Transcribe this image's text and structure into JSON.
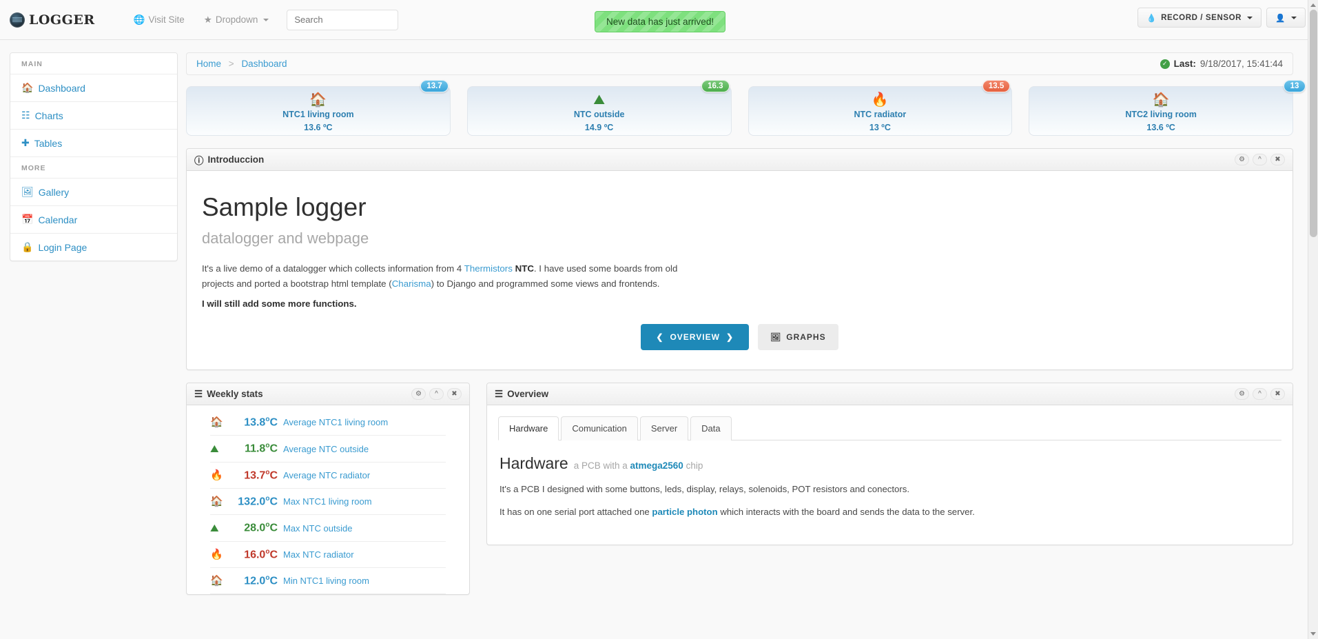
{
  "navbar": {
    "brand": "LOGGER",
    "links": [
      {
        "label": "Visit Site",
        "icon": "globe-icon"
      },
      {
        "label": "Dropdown",
        "icon": "star-icon"
      }
    ],
    "search_placeholder": "Search",
    "alert": "New data has just arrived!",
    "record_button": "RECORD / SENSOR",
    "user_icon": "user-icon"
  },
  "sidebar": {
    "groups": [
      {
        "heading": "MAIN",
        "items": [
          {
            "label": "Dashboard",
            "icon": "home-icon"
          },
          {
            "label": "Charts",
            "icon": "list-alt-icon"
          },
          {
            "label": "Tables",
            "icon": "plus-icon"
          }
        ]
      },
      {
        "heading": "MORE",
        "items": [
          {
            "label": "Gallery",
            "icon": "picture-icon"
          },
          {
            "label": "Calendar",
            "icon": "calendar-icon"
          },
          {
            "label": "Login Page",
            "icon": "lock-icon"
          }
        ]
      }
    ]
  },
  "breadcrumb": {
    "home": "Home",
    "separator": ">",
    "current": "Dashboard",
    "last_label": "Last:",
    "last_value": "9/18/2017, 15:41:44"
  },
  "sensor_cards": [
    {
      "title": "NTC1 living room",
      "value": "13.6 ºC",
      "badge": "13.7",
      "badge_color": "#3aa5db",
      "icon": "home-icon",
      "icon_color": "#2d8fc4"
    },
    {
      "title": "NTC outside",
      "value": "14.9 ºC",
      "badge": "16.3",
      "badge_color": "#4cae4c",
      "icon": "road-icon",
      "icon_color": "#3a8c3a"
    },
    {
      "title": "NTC radiator",
      "value": "13 ºC",
      "badge": "13.5",
      "badge_color": "#e5603f",
      "icon": "fire-icon",
      "icon_color": "#c0392b"
    },
    {
      "title": "NTC2 living room",
      "value": "13.6 ºC",
      "badge": "13",
      "badge_color": "#3aa5db",
      "icon": "home-icon",
      "icon_color": "#2d8fc4"
    }
  ],
  "intro_panel": {
    "title": "Introduccion",
    "title_icon": "info-circle-icon",
    "tools": [
      "gear-icon",
      "chevron-up-icon",
      "close-icon"
    ],
    "hero": "Sample logger",
    "subtitle": "datalogger and webpage",
    "paragraph_part1": "It's a live demo of a datalogger which collects information from 4 ",
    "link_thermistors": "Thermistors",
    "paragraph_ntc": "NTC",
    "paragraph_part2": ". I have used some boards from old projects and ported a bootstrap html template (",
    "link_charisma": "Charisma",
    "paragraph_part3": ") to Django and programmed some views and frontends.",
    "strong_line": "I will still add some more functions.",
    "btn_overview": "OVERVIEW",
    "btn_graphs": "GRAPHS"
  },
  "weekly_panel": {
    "title": "Weekly stats",
    "title_icon": "list-icon",
    "tools": [
      "gear-icon",
      "chevron-up-icon",
      "close-icon"
    ],
    "rows": [
      {
        "icon": "home-icon",
        "color": "c-blue",
        "value": "13.8",
        "unit": "o",
        "unit2": "C",
        "label": "Average NTC1 living room"
      },
      {
        "icon": "road-icon",
        "color": "c-green",
        "value": "11.8",
        "unit": "o",
        "unit2": "C",
        "label": "Average NTC outside"
      },
      {
        "icon": "fire-icon",
        "color": "c-red",
        "value": "13.7",
        "unit": "o",
        "unit2": "C",
        "label": "Average NTC radiator"
      },
      {
        "icon": "home-icon",
        "color": "c-blue",
        "value": "132.0",
        "unit": "o",
        "unit2": "C",
        "label": "Max NTC1 living room"
      },
      {
        "icon": "road-icon",
        "color": "c-green",
        "value": "28.0",
        "unit": "o",
        "unit2": "C",
        "label": "Max NTC outside"
      },
      {
        "icon": "fire-icon",
        "color": "c-red",
        "value": "16.0",
        "unit": "o",
        "unit2": "C",
        "label": "Max NTC radiator"
      },
      {
        "icon": "home-icon",
        "color": "c-blue",
        "value": "12.0",
        "unit": "o",
        "unit2": "C",
        "label": "Min NTC1 living room"
      }
    ]
  },
  "overview_panel": {
    "title": "Overview",
    "title_icon": "list-icon",
    "tools": [
      "gear-icon",
      "chevron-up-icon",
      "close-icon"
    ],
    "tabs": [
      {
        "label": "Hardware",
        "active": true
      },
      {
        "label": "Comunication",
        "active": false
      },
      {
        "label": "Server",
        "active": false
      },
      {
        "label": "Data",
        "active": false
      }
    ],
    "pane_heading": "Hardware",
    "pane_sub_pre": "a PCB with a ",
    "pane_sub_link": "atmega2560",
    "pane_sub_post": " chip",
    "pane_p1": "It's a PCB I designed with some buttons, leds, display, relays, solenoids, POT resistors and conectors.",
    "pane_p2_pre": "It has on one serial port attached one ",
    "pane_p2_link": "particle photon",
    "pane_p2_post": " which interacts with the board and sends the data to the server."
  }
}
